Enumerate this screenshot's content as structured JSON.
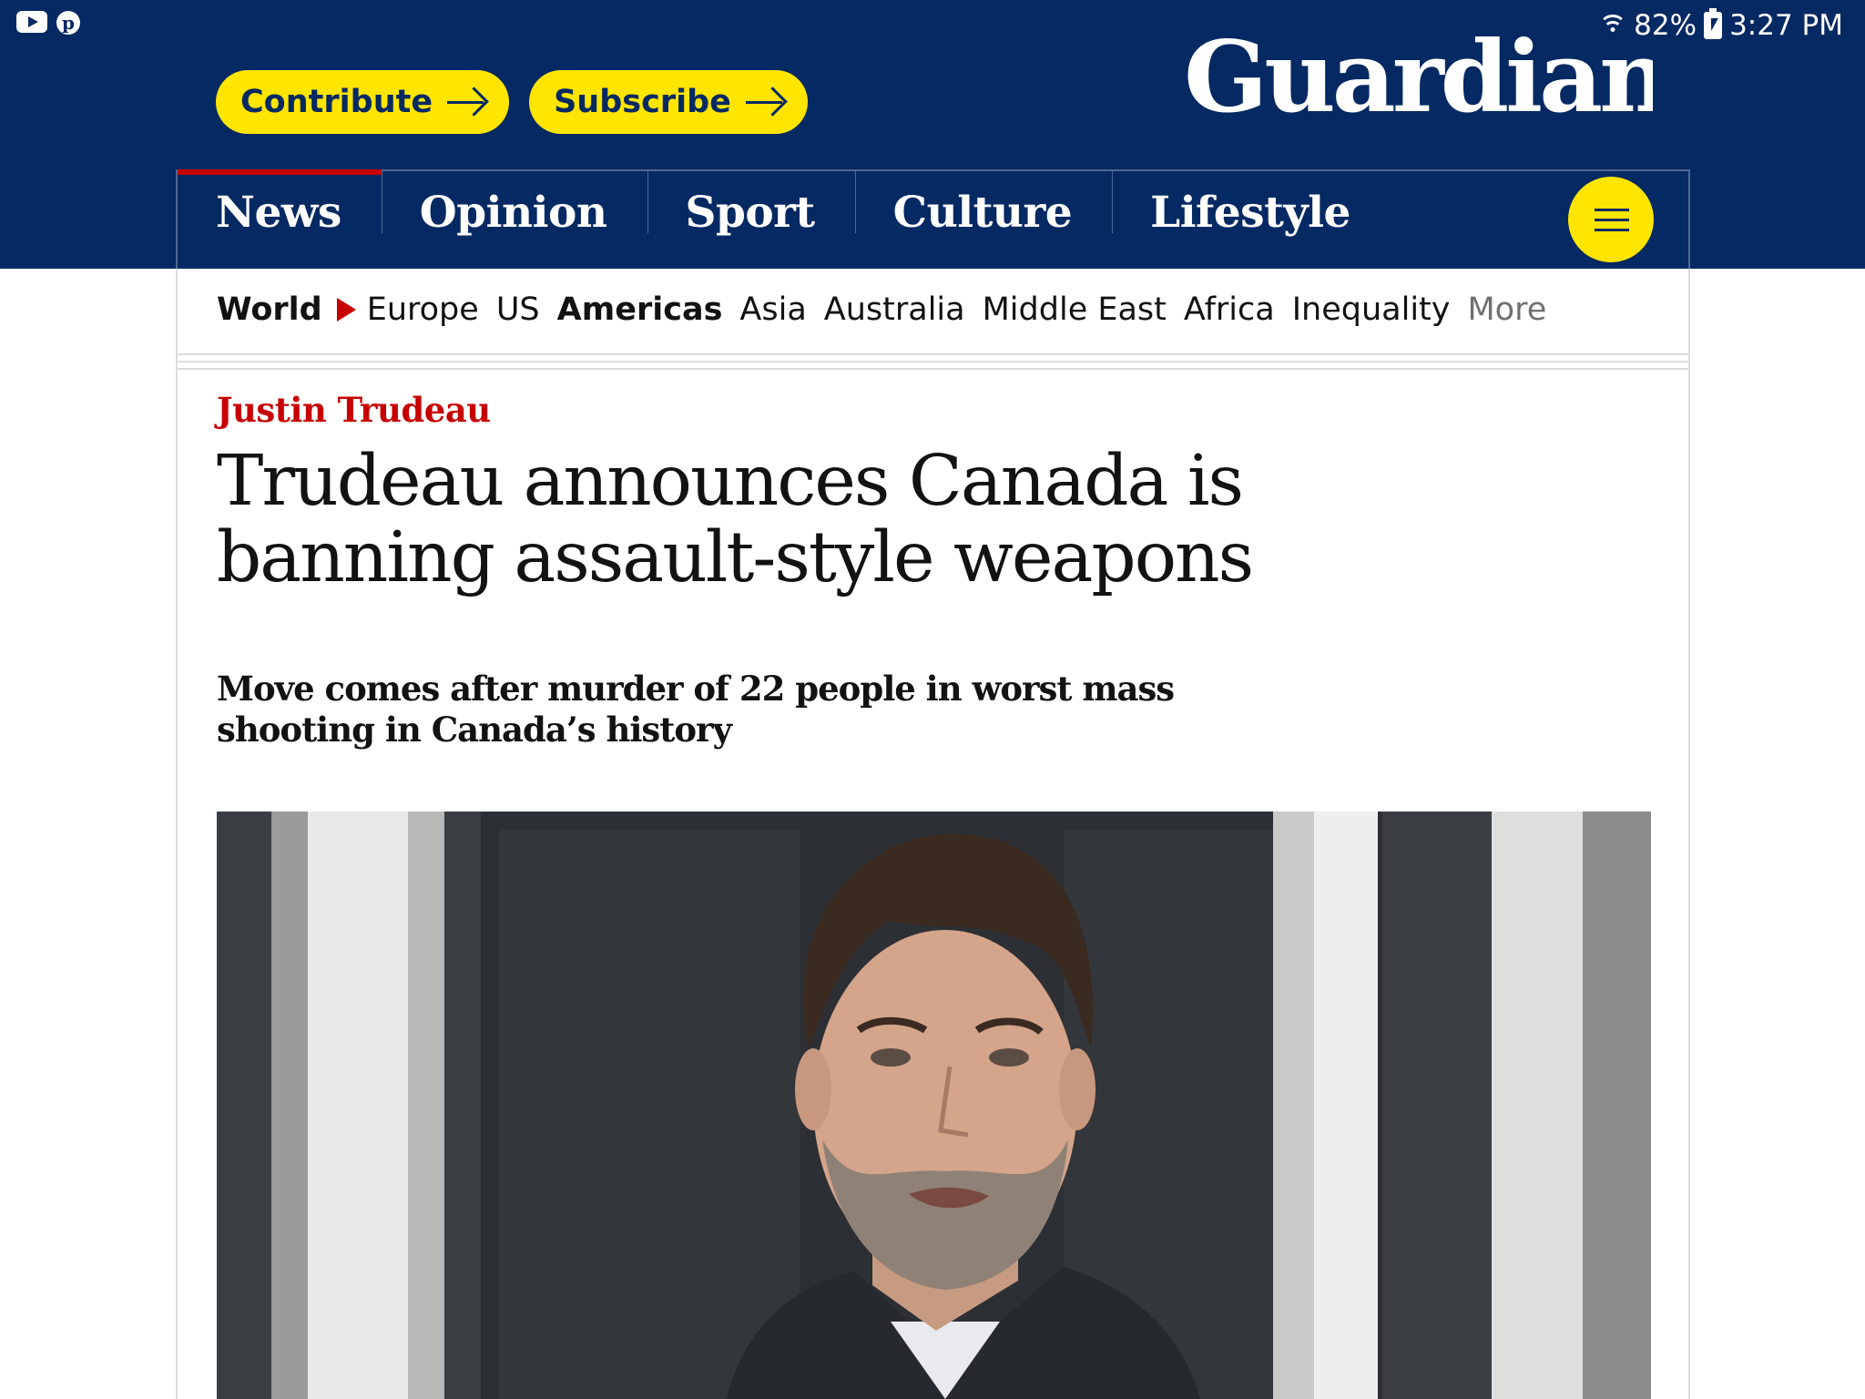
{
  "status_bar": {
    "battery": "82%",
    "time": "3:27 PM",
    "left_icons": [
      "youtube-icon",
      "pinterest-icon"
    ],
    "right_icons": [
      "wifi-icon",
      "battery-charging-icon"
    ]
  },
  "header": {
    "logo_text": "Guardian",
    "contribute_label": "Contribute",
    "subscribe_label": "Subscribe",
    "pillars": [
      {
        "label": "News",
        "active": true
      },
      {
        "label": "Opinion",
        "active": false
      },
      {
        "label": "Sport",
        "active": false
      },
      {
        "label": "Culture",
        "active": false
      },
      {
        "label": "Lifestyle",
        "active": false
      }
    ],
    "menu_icon": "hamburger-menu-icon"
  },
  "subnav": {
    "parent": "World",
    "items": [
      {
        "label": "Europe",
        "active": false
      },
      {
        "label": "US",
        "active": false
      },
      {
        "label": "Americas",
        "active": true
      },
      {
        "label": "Asia",
        "active": false
      },
      {
        "label": "Australia",
        "active": false
      },
      {
        "label": "Middle East",
        "active": false
      },
      {
        "label": "Africa",
        "active": false
      },
      {
        "label": "Inequality",
        "active": false
      }
    ],
    "more_label": "More"
  },
  "article": {
    "kicker": "Justin Trudeau",
    "headline": "Trudeau announces Canada is banning assault-style weapons",
    "standfirst": "Move comes after murder of 22 people in worst mass shooting in Canada’s history"
  },
  "colors": {
    "brand_blue": "#052962",
    "brand_yellow": "#ffe500",
    "news_red": "#c70000",
    "text": "#121212"
  }
}
